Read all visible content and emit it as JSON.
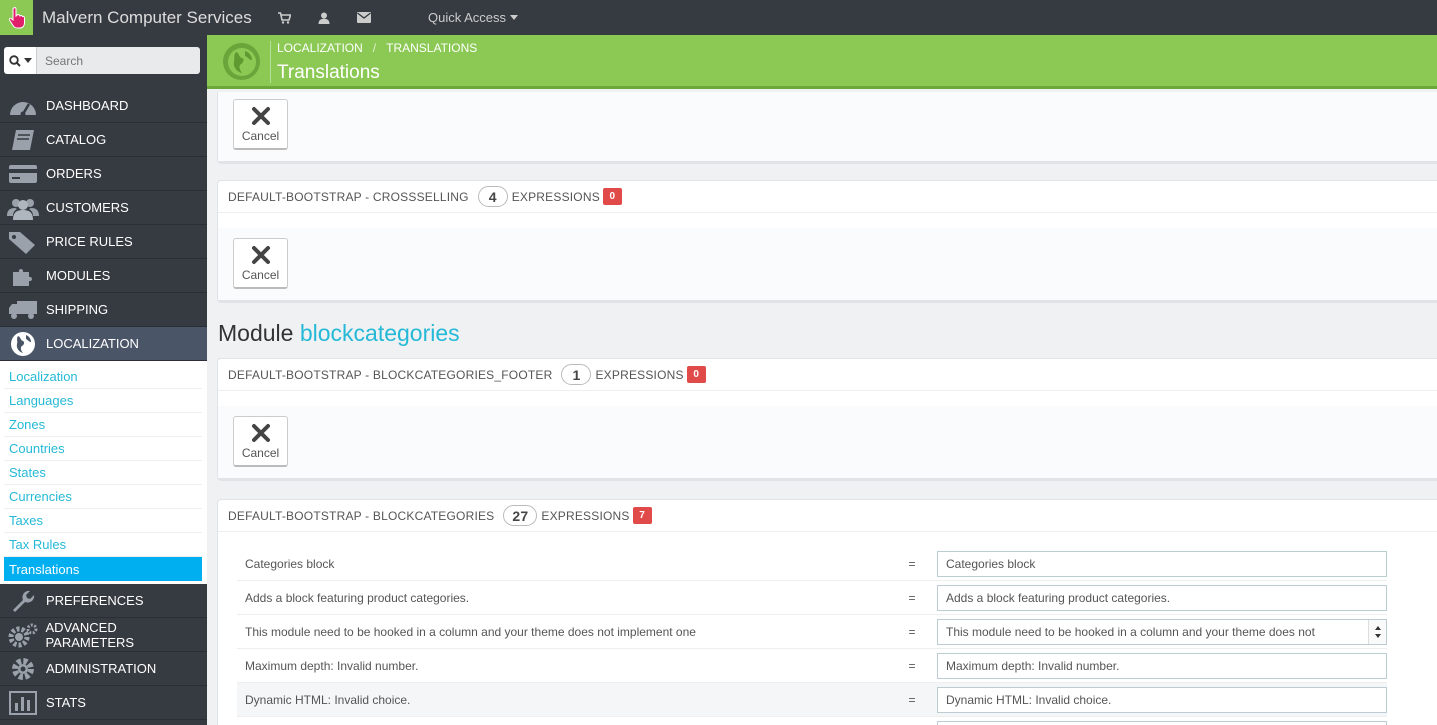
{
  "topbar": {
    "brand": "Malvern Computer Services",
    "quick_access": "Quick Access"
  },
  "search": {
    "placeholder": "Search"
  },
  "sidebar": {
    "items": [
      {
        "label": "DASHBOARD",
        "icon": "dashboard-icon"
      },
      {
        "label": "CATALOG",
        "icon": "book-icon"
      },
      {
        "label": "ORDERS",
        "icon": "credit-card-icon"
      },
      {
        "label": "CUSTOMERS",
        "icon": "users-icon"
      },
      {
        "label": "PRICE RULES",
        "icon": "tags-icon"
      },
      {
        "label": "MODULES",
        "icon": "puzzle-icon"
      },
      {
        "label": "SHIPPING",
        "icon": "truck-icon"
      },
      {
        "label": "LOCALIZATION",
        "icon": "globe-icon"
      }
    ],
    "submenu": [
      "Localization",
      "Languages",
      "Zones",
      "Countries",
      "States",
      "Currencies",
      "Taxes",
      "Tax Rules",
      "Translations"
    ],
    "items_after": [
      {
        "label": "PREFERENCES",
        "icon": "wrench-icon"
      },
      {
        "label": "ADVANCED PARAMETERS",
        "icon": "cogs-icon"
      },
      {
        "label": "ADMINISTRATION",
        "icon": "gear-icon"
      },
      {
        "label": "STATS",
        "icon": "bar-chart-icon"
      }
    ]
  },
  "header": {
    "breadcrumb": [
      "LOCALIZATION",
      "TRANSLATIONS"
    ],
    "title": "Translations"
  },
  "panels": {
    "cancel_label": "Cancel",
    "crossselling": {
      "name": "DEFAULT-BOOTSTRAP - CROSSSELLING",
      "count": "4",
      "expr": "EXPRESSIONS",
      "missing": "0"
    },
    "footer": {
      "name": "DEFAULT-BOOTSTRAP - BLOCKCATEGORIES_FOOTER",
      "count": "1",
      "expr": "EXPRESSIONS",
      "missing": "0"
    },
    "blockcats": {
      "name": "DEFAULT-BOOTSTRAP - BLOCKCATEGORIES",
      "count": "27",
      "expr": "EXPRESSIONS",
      "missing": "7"
    }
  },
  "module": {
    "prefix": "Module",
    "name": "blockcategories"
  },
  "translations": [
    {
      "source": "Categories block",
      "value": "Categories block"
    },
    {
      "source": "Adds a block featuring product categories.",
      "value": "Adds a block featuring product categories."
    },
    {
      "source": "This module need to be hooked in a column and your theme does not implement one",
      "value": "This module need to be hooked in a column and your theme does not"
    },
    {
      "source": "Maximum depth: Invalid number.",
      "value": "Maximum depth: Invalid number."
    },
    {
      "source": "Dynamic HTML: Invalid choice.",
      "value": "Dynamic HTML: Invalid choice."
    }
  ]
}
